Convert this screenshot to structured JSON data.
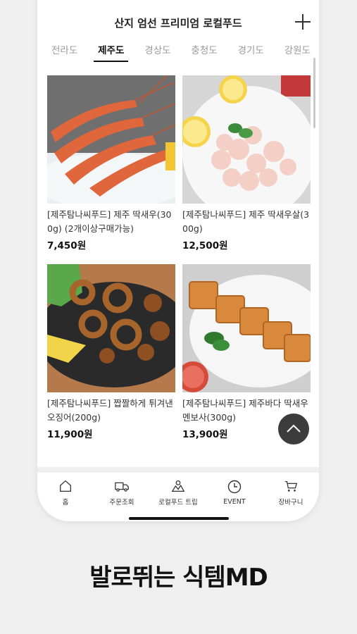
{
  "header": {
    "title": "산지 엄선 프리미엄 로컬푸드",
    "add_icon": "plus-icon"
  },
  "tabs": [
    {
      "label": "전라도",
      "active": false
    },
    {
      "label": "제주도",
      "active": true
    },
    {
      "label": "경상도",
      "active": false
    },
    {
      "label": "충청도",
      "active": false
    },
    {
      "label": "경기도",
      "active": false
    },
    {
      "label": "강원도",
      "active": false
    }
  ],
  "products": [
    {
      "name": "[제주탐나씨푸드] 제주 딱새우(300g) (2개이상구매가능)",
      "price": "7,450원"
    },
    {
      "name": "[제주탐나씨푸드] 제주 딱새우살(300g)",
      "price": "12,500원"
    },
    {
      "name": "[제주탐나씨푸드] 짭짤하게 튀겨낸 오징어(200g)",
      "price": "11,900원"
    },
    {
      "name": "[제주탐나씨푸드] 제주바다 딱새우 멘보사(300g)",
      "price": "13,900원"
    }
  ],
  "tabbar": [
    {
      "label": "홈",
      "icon": "home-icon"
    },
    {
      "label": "주문조회",
      "icon": "truck-icon"
    },
    {
      "label": "로컬푸드 트립",
      "icon": "trip-icon"
    },
    {
      "label": "EVENT",
      "icon": "clock-icon"
    },
    {
      "label": "장바구니",
      "icon": "cart-icon"
    }
  ],
  "slogan": "발로뛰는 식템MD",
  "colors": {
    "accent": "#111111",
    "inactive_tab": "#9a9a9a",
    "background": "#efefef"
  }
}
